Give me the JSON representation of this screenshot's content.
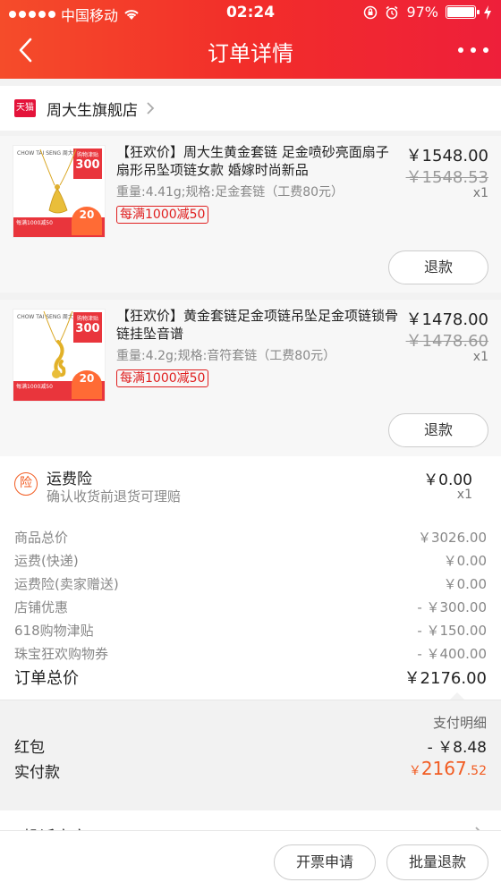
{
  "status_bar": {
    "carrier": "中国移动",
    "time": "02:24",
    "battery": "97%"
  },
  "nav": {
    "title": "订单详情"
  },
  "shop": {
    "logo_text": "天猫",
    "name": "周大生旗舰店"
  },
  "products": [
    {
      "title": "【狂欢价】周大生黄金套链 足金喷砂亮面扇子扇形吊坠项链女款 婚嫁时尚新品",
      "spec": "重量:4.41g;规格:足金套链（工费80元）",
      "promo": "每满1000减50",
      "price": "￥1548.00",
      "original_price": "￥1548.53",
      "quantity": "x1",
      "refund_label": "退款",
      "image_brand": "CHOW TAI SENG 周大生",
      "image_badge_top": "购物津贴",
      "image_badge_num": "300",
      "image_promo_text": "每满1000减50",
      "image_promo_num": "20"
    },
    {
      "title": "【狂欢价】黄金套链足金项链吊坠足金项链锁骨链挂坠音谱",
      "spec": "重量:4.2g;规格:音符套链（工费80元）",
      "promo": "每满1000减50",
      "price": "￥1478.00",
      "original_price": "￥1478.60",
      "quantity": "x1",
      "refund_label": "退款",
      "image_brand": "CHOW TAI SENG 周大生",
      "image_badge_top": "购物津贴",
      "image_badge_num": "300",
      "image_promo_text": "每满1000减50",
      "image_promo_num": "20"
    }
  ],
  "insurance": {
    "icon_text": "险",
    "title": "运费险",
    "subtitle": "确认收货前退货可理赔",
    "price": "￥0.00",
    "quantity": "x1"
  },
  "summary": {
    "rows": [
      {
        "label": "商品总价",
        "value": "￥3026.00"
      },
      {
        "label": "运费(快递)",
        "value": "￥0.00"
      },
      {
        "label": "运费险(卖家赠送)",
        "value": "￥0.00"
      },
      {
        "label": "店铺优惠",
        "value": "- ￥300.00"
      },
      {
        "label": "618购物津贴",
        "value": "- ￥150.00"
      },
      {
        "label": "珠宝狂欢购物券",
        "value": "- ￥400.00"
      }
    ],
    "total_label": "订单总价",
    "total_value": "￥2176.00"
  },
  "payment": {
    "detail_label": "支付明细",
    "redpacket_label": "红包",
    "redpacket_value": "- ￥8.48",
    "paid_label": "实付款",
    "paid_currency": "￥",
    "paid_int": "2167",
    "paid_dec": ".52"
  },
  "nearby": {
    "label": "投诉商家"
  },
  "bottom_bar": {
    "invoice_label": "开票申请",
    "batch_refund_label": "批量退款"
  },
  "colors": {
    "header_start": "#f54c2a",
    "header_end": "#ee1f3a",
    "accent_orange": "#f25c22",
    "promo_red": "#e02020"
  }
}
